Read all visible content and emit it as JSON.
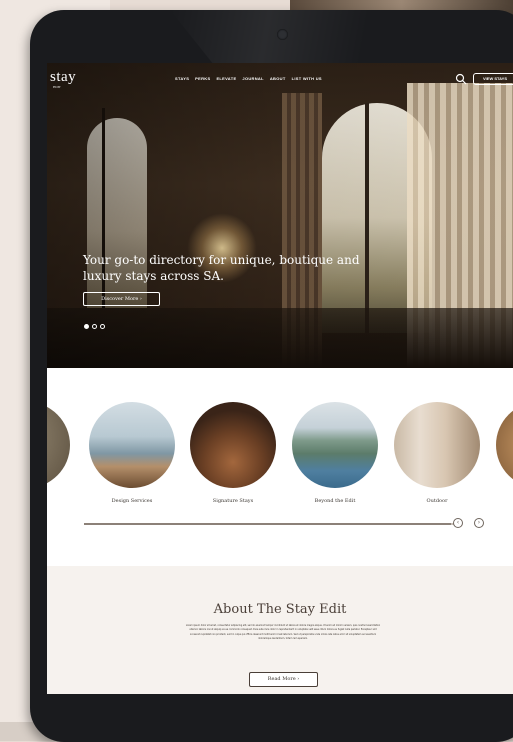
{
  "header": {
    "logo": "stay",
    "logo_sub": "EDIT",
    "nav": [
      "STAYS",
      "PERKS",
      "ELEVATE",
      "JOURNAL",
      "ABOUT",
      "LIST WITH US"
    ],
    "view_button": "VIEW STAYS"
  },
  "hero": {
    "title": "Your go-to directory for unique, boutique and luxury stays across SA.",
    "cta": "Discover More ›",
    "slides": 3,
    "active_slide": 1
  },
  "categories": {
    "items": [
      {
        "label": "Design Services"
      },
      {
        "label": "Signature Stays"
      },
      {
        "label": "Beyond the Edit"
      },
      {
        "label": "Outdoor"
      }
    ],
    "scroll_progress": 0.98,
    "prev_arrow": "‹",
    "next_arrow": "›"
  },
  "about": {
    "title": "About The Stay Edit",
    "body": "Lorem ipsum dolor sit amet, consectetur adipiscing elit, sed do eiusmod tempor incididunt ut labore et dolore magna aliqua. Ut enim ad minim veniam, quis nostrud exercitation ullamco laboris nisi ut aliquip ex ea commodo consequat. Duis aute irure dolor in reprehenderit in voluptate velit esse cillum dolore eu fugiat nulla pariatur. Excepteur sint occaecat cupidatat non proident, sunt in culpa qui officia deserunt mollit anim id est laborum. Sed ut perspiciatis unde omnis iste natus error sit voluptatem accusantium doloremque laudantium, totam rem aperiam.",
    "read_more": "Read More ›"
  },
  "colors": {
    "page_bg": "#e7dcd4",
    "device": "#1a1b1e",
    "about_bg": "#f6f2ee",
    "text_dark": "#3a332d"
  }
}
